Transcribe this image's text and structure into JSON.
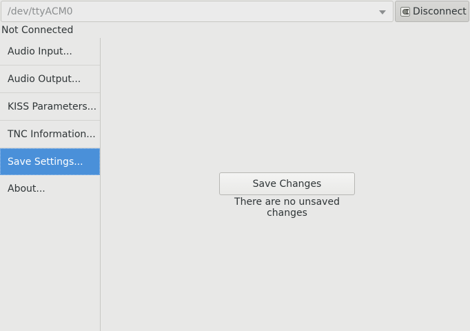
{
  "connection": {
    "port": "/dev/ttyACM0",
    "disconnect_label": "Disconnect",
    "status": "Not Connected"
  },
  "sidebar": {
    "items": [
      {
        "label": "Audio Input..."
      },
      {
        "label": "Audio Output..."
      },
      {
        "label": "KISS Parameters..."
      },
      {
        "label": "TNC Information..."
      },
      {
        "label": "Save Settings...",
        "selected": true
      },
      {
        "label": "About..."
      }
    ]
  },
  "main": {
    "save_button_label": "Save Changes",
    "save_status": "There are no unsaved changes"
  },
  "colors": {
    "selection": "#4a90d9",
    "background": "#e8e8e7"
  }
}
